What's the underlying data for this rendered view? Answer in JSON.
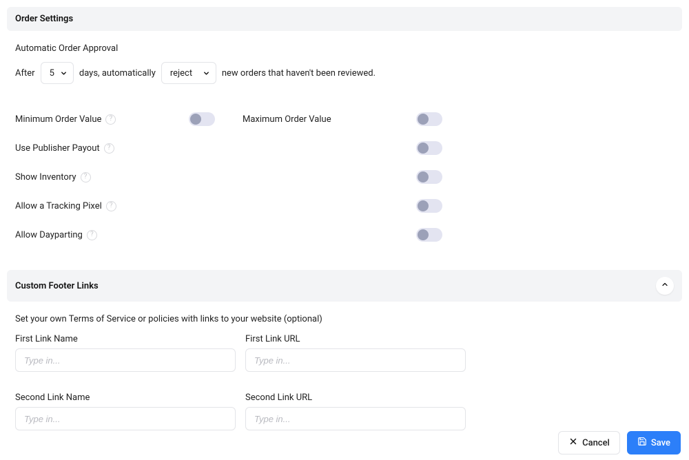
{
  "order_settings": {
    "header": "Order Settings",
    "auto_approval": {
      "label": "Automatic Order Approval",
      "prefix": "After",
      "days_value": "5",
      "mid_text": "days, automatically",
      "action_value": "reject",
      "suffix": "new orders that haven't been reviewed."
    },
    "items": {
      "min_order_label": "Minimum Order Value",
      "max_order_label": "Maximum Order Value",
      "publisher_payout_label": "Use Publisher Payout",
      "show_inventory_label": "Show Inventory",
      "tracking_pixel_label": "Allow a Tracking Pixel",
      "dayparting_label": "Allow Dayparting"
    }
  },
  "footer_links": {
    "header": "Custom Footer Links",
    "description": "Set your own Terms of Service or policies with links to your website (optional)",
    "fields": {
      "first_name_label": "First Link Name",
      "first_url_label": "First Link URL",
      "second_name_label": "Second Link Name",
      "second_url_label": "Second Link URL",
      "placeholder": "Type in..."
    }
  },
  "actions": {
    "cancel": "Cancel",
    "save": "Save"
  }
}
